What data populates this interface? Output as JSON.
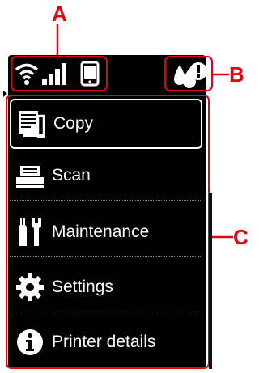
{
  "callouts": {
    "a": "A",
    "b": "B",
    "c": "C"
  },
  "status_bar": {
    "icons": [
      "wifi-icon",
      "signal-bars-icon",
      "mobile-device-icon",
      "ink-warning-icon"
    ]
  },
  "menu": {
    "items": [
      {
        "label": "Copy",
        "icon": "copy-icon",
        "selected": true
      },
      {
        "label": "Scan",
        "icon": "scan-icon"
      },
      {
        "label": "Maintenance",
        "icon": "maintenance-icon"
      },
      {
        "label": "Settings",
        "icon": "settings-gear-icon"
      },
      {
        "label": "Printer details",
        "icon": "info-icon"
      }
    ]
  },
  "colors": {
    "callout": "#e60012",
    "screen": "#000000",
    "text": "#ffffff"
  }
}
